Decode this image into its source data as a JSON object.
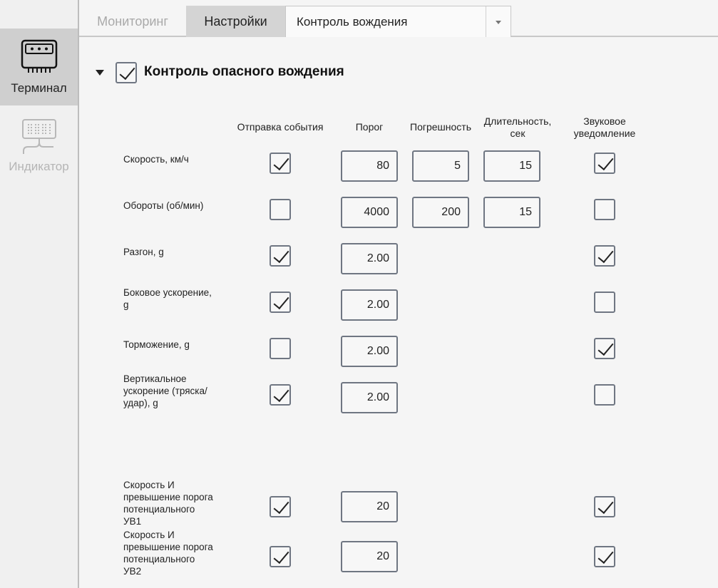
{
  "sidebar": {
    "items": [
      {
        "label": "Терминал",
        "icon": "terminal-icon",
        "active": true
      },
      {
        "label": "Индикатор",
        "icon": "indicator-icon",
        "active": false
      }
    ]
  },
  "tabs": {
    "monitoring": "Мониторинг",
    "settings": "Настройки",
    "dropdown_value": "Контроль вождения"
  },
  "section": {
    "title": "Контроль опасного вождения",
    "enabled": true
  },
  "columns": {
    "send_event": "Отправка события",
    "threshold": "Порог",
    "tolerance": "Погрешность",
    "duration_line1": "Длительность,",
    "duration_line2": "сек",
    "sound_line1": "Звуковое",
    "sound_line2": "уведомление"
  },
  "rows": [
    {
      "label_lines": [
        "Скорость, км/ч"
      ],
      "send": true,
      "threshold": "80",
      "tolerance": "5",
      "duration": "15",
      "sound": true
    },
    {
      "label_lines": [
        "Обороты (об/мин)"
      ],
      "send": false,
      "threshold": "4000",
      "tolerance": "200",
      "duration": "15",
      "sound": false
    },
    {
      "label_lines": [
        "Разгон, g"
      ],
      "send": true,
      "threshold": "2.00",
      "sound": true
    },
    {
      "label_lines": [
        "Боковое ускорение,",
        "g"
      ],
      "send": true,
      "threshold": "2.00",
      "sound": false
    },
    {
      "label_lines": [
        "Торможение, g"
      ],
      "send": false,
      "threshold": "2.00",
      "sound": true
    },
    {
      "label_lines": [
        "Вертикальное",
        "ускорение (тряска/",
        "удар), g"
      ],
      "send": true,
      "threshold": "2.00",
      "sound": false
    },
    {
      "label_lines": [
        "Скорость И",
        "превышение порога",
        "потенциального",
        "УВ1"
      ],
      "send": true,
      "threshold": "20",
      "sound": true
    },
    {
      "label_lines": [
        "Скорость И",
        "превышение порога",
        "потенциального",
        "УВ2"
      ],
      "send": true,
      "threshold": "20",
      "sound": true
    }
  ]
}
